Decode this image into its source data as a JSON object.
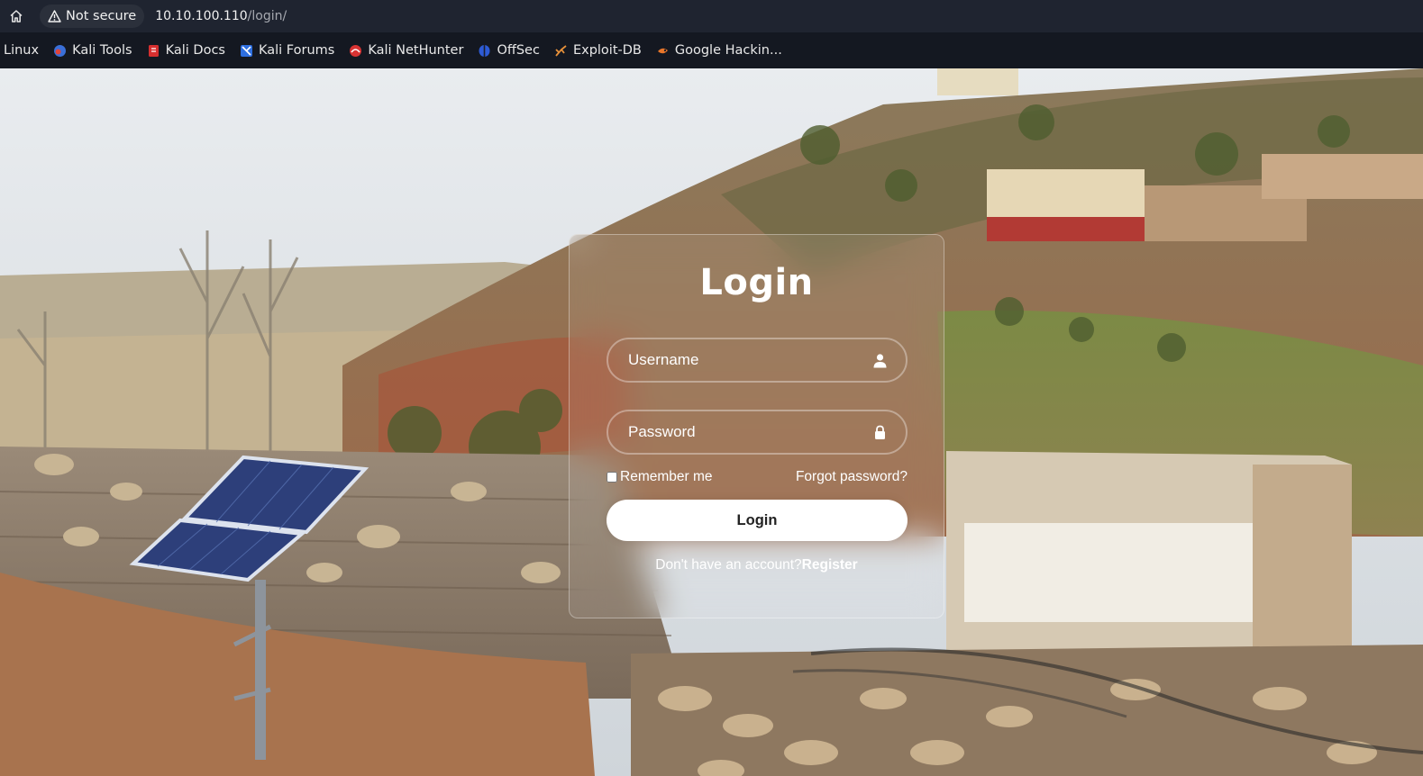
{
  "browser": {
    "security_label": "Not secure",
    "url_host": "10.10.100.110",
    "url_path": "/login/",
    "bookmarks": [
      {
        "label": "Linux",
        "icon": "none"
      },
      {
        "label": "Kali Tools",
        "icon": "kali-tools-icon"
      },
      {
        "label": "Kali Docs",
        "icon": "kali-docs-icon"
      },
      {
        "label": "Kali Forums",
        "icon": "kali-forums-icon"
      },
      {
        "label": "Kali NetHunter",
        "icon": "kali-nethunter-icon"
      },
      {
        "label": "OffSec",
        "icon": "offsec-icon"
      },
      {
        "label": "Exploit-DB",
        "icon": "exploit-db-icon"
      },
      {
        "label": "Google Hackin...",
        "icon": "google-hacking-icon"
      }
    ]
  },
  "login": {
    "title": "Login",
    "username_placeholder": "Username",
    "password_placeholder": "Password",
    "remember_label": "Remember me",
    "forgot_label": "Forgot password?",
    "submit_label": "Login",
    "register_prompt": "Don't have an account?",
    "register_link": "Register"
  },
  "colors": {
    "chrome_top": "#1f2430",
    "bookmarks_bar": "#141821",
    "card_text": "#ffffff",
    "button_bg": "#ffffff"
  }
}
